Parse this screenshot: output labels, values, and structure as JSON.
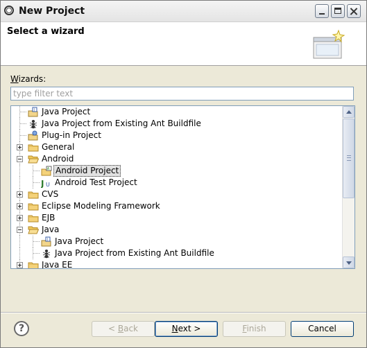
{
  "window": {
    "title": "New Project"
  },
  "header": {
    "title": "Select a wizard"
  },
  "wizards": {
    "label_mnemonic": "W",
    "label_rest": "izards:"
  },
  "filter": {
    "placeholder": "type filter text",
    "value": ""
  },
  "tree": {
    "items": [
      {
        "label": "Java Project",
        "level": 1,
        "icon": "java-project-icon",
        "toggle": "none",
        "selected": false
      },
      {
        "label": "Java Project from Existing Ant Buildfile",
        "level": 1,
        "icon": "ant-icon",
        "toggle": "none",
        "selected": false
      },
      {
        "label": "Plug-in Project",
        "level": 1,
        "icon": "plugin-project-icon",
        "toggle": "none",
        "selected": false
      },
      {
        "label": "General",
        "level": 1,
        "icon": "folder-icon",
        "toggle": "plus",
        "selected": false
      },
      {
        "label": "Android",
        "level": 1,
        "icon": "folder-open-icon",
        "toggle": "minus",
        "selected": false
      },
      {
        "label": "Android Project",
        "level": 2,
        "icon": "android-project-icon",
        "toggle": "none",
        "selected": true
      },
      {
        "label": "Android Test Project",
        "level": 2,
        "icon": "junit-icon",
        "toggle": "none",
        "selected": false
      },
      {
        "label": "CVS",
        "level": 1,
        "icon": "folder-icon",
        "toggle": "plus",
        "selected": false
      },
      {
        "label": "Eclipse Modeling Framework",
        "level": 1,
        "icon": "folder-icon",
        "toggle": "plus",
        "selected": false
      },
      {
        "label": "EJB",
        "level": 1,
        "icon": "folder-icon",
        "toggle": "plus",
        "selected": false
      },
      {
        "label": "Java",
        "level": 1,
        "icon": "folder-open-icon",
        "toggle": "minus",
        "selected": false
      },
      {
        "label": "Java Project",
        "level": 2,
        "icon": "java-project-icon",
        "toggle": "none",
        "selected": false
      },
      {
        "label": "Java Project from Existing Ant Buildfile",
        "level": 2,
        "icon": "ant-icon",
        "toggle": "none",
        "selected": false
      },
      {
        "label": "Java EE",
        "level": 1,
        "icon": "folder-icon",
        "toggle": "plus",
        "selected": false
      }
    ]
  },
  "buttons": {
    "back": {
      "mnemonic": "B",
      "prefix": "< ",
      "rest": "ack",
      "enabled": false
    },
    "next": {
      "mnemonic": "N",
      "prefix": "",
      "rest": "ext >",
      "enabled": true
    },
    "finish": {
      "mnemonic": "F",
      "prefix": "",
      "rest": "inish",
      "enabled": false
    },
    "cancel": {
      "label": "Cancel",
      "enabled": true
    }
  },
  "help": {
    "glyph": "?"
  },
  "colors": {
    "selection": "#e1e1e1",
    "border": "#7f9db9",
    "button_border": "#003c74"
  }
}
